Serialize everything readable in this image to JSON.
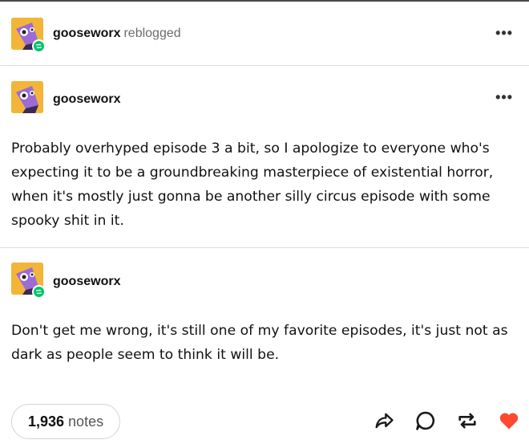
{
  "reblog_header": {
    "username": "gooseworx",
    "action": "reblogged",
    "more_label": "•••"
  },
  "posts": [
    {
      "username": "gooseworx",
      "more_label": "•••",
      "text": "Probably overhyped episode 3 a bit, so I apologize to everyone who's expecting it to be a groundbreaking masterpiece of existential horror, when it's mostly just gonna be another silly circus episode with some spooky shit in it."
    },
    {
      "username": "gooseworx",
      "text": "Don't get me wrong, it's still one of my favorite episodes, it's just not as dark as people seem to think it will be."
    }
  ],
  "footer": {
    "notes_count": "1,936",
    "notes_label": "notes"
  },
  "colors": {
    "avatar_bg": "#f2b53a",
    "reblog_badge": "#00c46a",
    "heart": "#ff4930"
  },
  "icons": [
    "share-icon",
    "reply-icon",
    "reblog-icon",
    "heart-icon",
    "more-icon"
  ]
}
